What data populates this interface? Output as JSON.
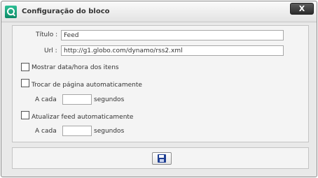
{
  "dialog": {
    "title": "Configuração do bloco",
    "close_label": "X",
    "accent_color": "#1fa07a"
  },
  "form": {
    "titulo_label": "Título :",
    "titulo_value": "Feed",
    "url_label": "Url :",
    "url_value": "http://g1.globo.com/dynamo/rss2.xml",
    "mostrar_data_label": "Mostrar data/hora dos itens",
    "mostrar_data_checked": false,
    "trocar_pagina_label": "Trocar de página automaticamente",
    "trocar_pagina_checked": false,
    "a_cada_label_1": "A cada",
    "segundos_label_1": "segundos",
    "interval_1_value": "",
    "atualizar_feed_label": "Atualizar feed automaticamente",
    "atualizar_feed_checked": false,
    "a_cada_label_2": "A cada",
    "segundos_label_2": "segundos",
    "interval_2_value": ""
  },
  "footer": {
    "save_icon": "floppy-disk-icon"
  }
}
